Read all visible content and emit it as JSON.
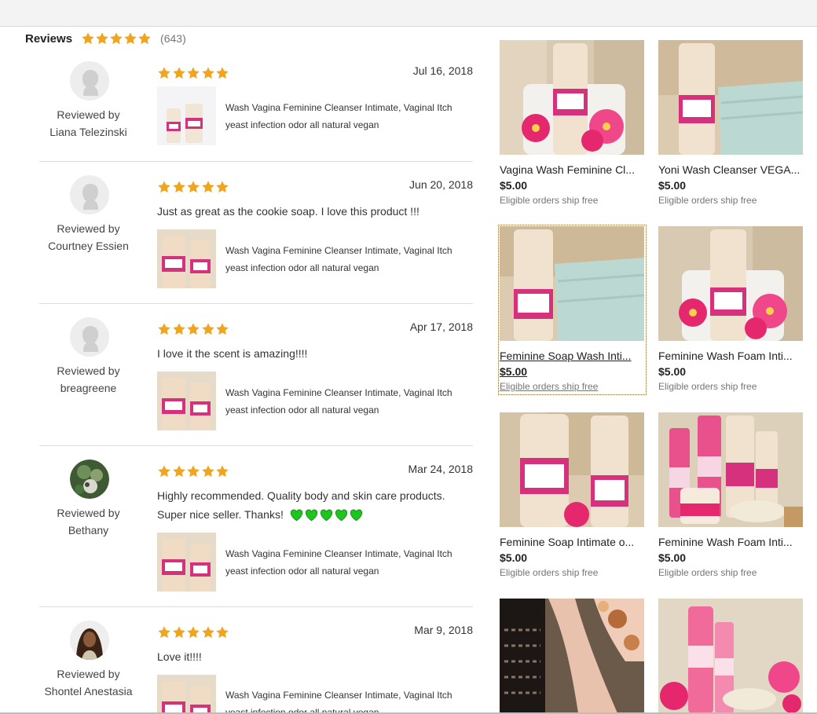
{
  "header": {
    "title": "Reviews",
    "rating": 5,
    "count": "(643)"
  },
  "colors": {
    "star": "#f1a41d",
    "heart": "#1fc51f",
    "accent": "#d6317c"
  },
  "reviews": [
    {
      "reviewed_by": "Reviewed by",
      "reviewer": "Liana Telezinski",
      "date": "Jul 16, 2018",
      "rating": 5,
      "text": "",
      "product": "Wash Vagina Feminine Cleanser Intimate, Vaginal Itch yeast infection odor all natural vegan",
      "avatar": "default-avatar"
    },
    {
      "reviewed_by": "Reviewed by",
      "reviewer": "Courtney Essien",
      "date": "Jun 20, 2018",
      "rating": 5,
      "text": "Just as great as the cookie soap. I love this product !!!",
      "product": "Wash Vagina Feminine Cleanser Intimate, Vaginal Itch yeast infection odor all natural vegan",
      "avatar": "default-avatar"
    },
    {
      "reviewed_by": "Reviewed by",
      "reviewer": "breagreene",
      "date": "Apr 17, 2018",
      "rating": 5,
      "text": "I love it the scent is amazing!!!!",
      "product": "Wash Vagina Feminine Cleanser Intimate, Vaginal Itch yeast infection odor all natural vegan",
      "avatar": "default-avatar"
    },
    {
      "reviewed_by": "Reviewed by",
      "reviewer": "Bethany",
      "date": "Mar 24, 2018",
      "rating": 5,
      "text": "Highly recommended. Quality body and skin care products. Super nice seller. Thanks!",
      "hearts": 5,
      "product": "Wash Vagina Feminine Cleanser Intimate, Vaginal Itch yeast infection odor all natural vegan",
      "avatar": "photo-avatar"
    },
    {
      "reviewed_by": "Reviewed by",
      "reviewer": "Shontel Anestasia",
      "date": "Mar 9, 2018",
      "rating": 5,
      "text": "Love it!!!!",
      "product": "Wash Vagina Feminine Cleanser Intimate, Vaginal Itch yeast infection odor all natural vegan",
      "avatar": "photo-avatar"
    }
  ],
  "listings": [
    {
      "title": "Vagina Wash Feminine Cl...",
      "price": "$5.00",
      "shipping": "Eligible orders ship free"
    },
    {
      "title": "Yoni Wash Cleanser VEGA...",
      "price": "$5.00",
      "shipping": "Eligible orders ship free"
    },
    {
      "title": "Feminine Soap Wash Inti...",
      "price": "$5.00",
      "shipping": "Eligible orders ship free"
    },
    {
      "title": "Feminine Wash Foam Inti...",
      "price": "$5.00",
      "shipping": "Eligible orders ship free"
    },
    {
      "title": "Feminine Soap Intimate o...",
      "price": "$5.00",
      "shipping": "Eligible orders ship free"
    },
    {
      "title": "Feminine Wash Foam Inti...",
      "price": "$5.00",
      "shipping": "Eligible orders ship free"
    },
    {
      "title": "",
      "price": "",
      "shipping": ""
    },
    {
      "title": "",
      "price": "",
      "shipping": ""
    }
  ]
}
